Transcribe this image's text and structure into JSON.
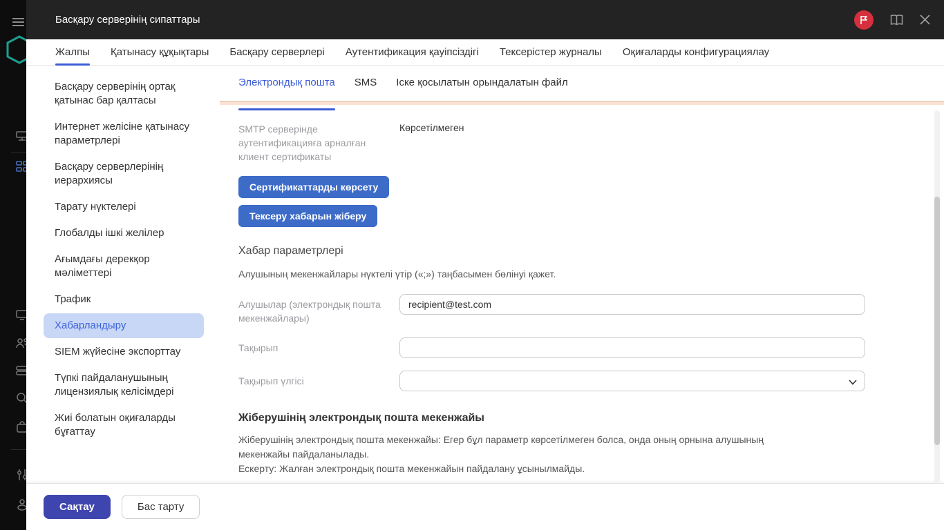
{
  "window": {
    "title": "Басқару серверінің сипаттары"
  },
  "tabs": {
    "items": [
      {
        "label": "Жалпы",
        "active": true
      },
      {
        "label": "Қатынасу құқықтары",
        "active": false
      },
      {
        "label": "Басқару серверлері",
        "active": false
      },
      {
        "label": "Аутентификация қауіпсіздігі",
        "active": false
      },
      {
        "label": "Тексерістер журналы",
        "active": false
      },
      {
        "label": "Оқиғаларды конфигурациялау",
        "active": false
      }
    ]
  },
  "sidebar_nav": {
    "items": [
      {
        "label": "Басқару серверінің ортақ қатынас бар қалтасы",
        "selected": false
      },
      {
        "label": "Интернет желісіне қатынасу параметрлері",
        "selected": false
      },
      {
        "label": "Басқару серверлерінің иерархиясы",
        "selected": false
      },
      {
        "label": "Тарату нүктелері",
        "selected": false
      },
      {
        "label": "Глобалды ішкі желілер",
        "selected": false
      },
      {
        "label": "Ағымдағы дерекқор мәліметтері",
        "selected": false
      },
      {
        "label": "Трафик",
        "selected": false
      },
      {
        "label": "Хабарландыру",
        "selected": true
      },
      {
        "label": "SIEM жүйесіне экспорттау",
        "selected": false
      },
      {
        "label": "Түпкі пайдаланушының лицензиялық келісімдері",
        "selected": false
      },
      {
        "label": "Жиі болатын оқиғаларды бұғаттау",
        "selected": false
      }
    ]
  },
  "subtabs": {
    "items": [
      {
        "label": "Электрондық пошта",
        "active": true
      },
      {
        "label": "SMS",
        "active": false
      },
      {
        "label": "Іске қосылатын орындалатын файл",
        "active": false
      }
    ]
  },
  "form": {
    "smtp_cert_label": "SMTP серверінде аутентификацияға арналған клиент сертификаты",
    "smtp_cert_value": "Көрсетілмеген",
    "show_certificates_button": "Сертификаттарды көрсету",
    "send_test_button": "Тексеру хабарын жіберу",
    "message_params_heading": "Хабар параметрлері",
    "recipients_hint": "Алушының мекенжайлары нүктелі үтір («;») таңбасымен бөлінуі қажет.",
    "recipients_label": "Алушылар (электрондық пошта мекенжайлары)",
    "recipients_value": "recipient@test.com",
    "subject_label": "Тақырып",
    "subject_value": "",
    "subject_template_label": "Тақырып үлгісі",
    "subject_template_value": "",
    "sender_heading": "Жіберушінің электрондық пошта мекенжайы",
    "sender_hint_line1": "Жіберушінің электрондық пошта мекенжайы: Егер бұл параметр көрсетілмеген болса, онда оның орнына алушының мекенжайы пайдаланылады.",
    "sender_hint_line2": "Ескерту: Жалған электрондық пошта мекенжайын пайдалану ұсынылмайды.",
    "sender_value": ""
  },
  "footer": {
    "save_label": "Сақтау",
    "cancel_label": "Бас тарту"
  },
  "colors": {
    "accent_blue": "#3b5bd7",
    "button_blue": "#3d6cc8",
    "save_indigo": "#3f45ae",
    "selected_pill": "#c9d7f7",
    "badge_red": "#d62f3d",
    "peach_band": "#fbe2d2",
    "header_dark": "#232323",
    "rail_dark": "#0d0d0d"
  }
}
